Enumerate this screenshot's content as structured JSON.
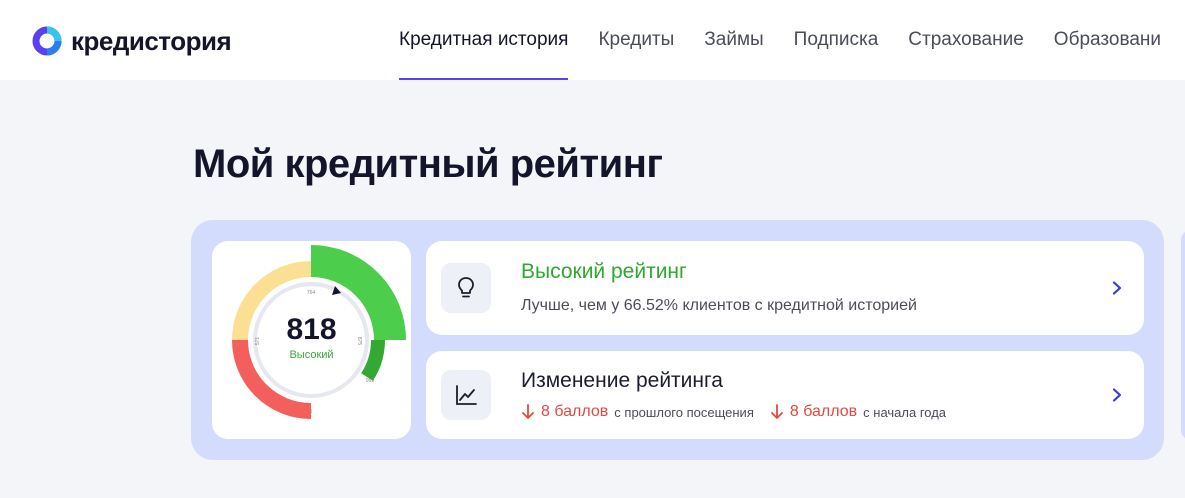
{
  "brand": {
    "name": "кредистория"
  },
  "nav": {
    "items": [
      {
        "label": "Кредитная история",
        "active": true
      },
      {
        "label": "Кредиты",
        "active": false
      },
      {
        "label": "Займы",
        "active": false
      },
      {
        "label": "Подписка",
        "active": false
      },
      {
        "label": "Страхование",
        "active": false
      },
      {
        "label": "Образовани",
        "active": false
      }
    ]
  },
  "page": {
    "title": "Мой кредитный рейтинг"
  },
  "gauge": {
    "score": "818",
    "score_label": "Высокий",
    "ticks": [
      "1",
      "571",
      "764",
      "875",
      "999"
    ],
    "colors": {
      "low": "#f25f5c",
      "mid": "#fbdf93",
      "high": "#4ccd4c",
      "high_dark": "#33a833",
      "track": "#e6e8ef"
    }
  },
  "rating_card": {
    "title": "Высокий рейтинг",
    "subtitle": "Лучше, чем у 66.52% клиентов с кредитной историей",
    "icon": "lightbulb-icon"
  },
  "change_card": {
    "title": "Изменение рейтинга",
    "icon": "chart-line-icon",
    "deltas": [
      {
        "value": "8 баллов",
        "note": "с прошлого посещения",
        "direction": "down"
      },
      {
        "value": "8 баллов",
        "note": "с начала года",
        "direction": "down"
      }
    ]
  },
  "colors": {
    "accent": "#5b3ff0",
    "positive": "#2ea82e",
    "negative": "#e2483f",
    "panel": "#d3dcfd"
  }
}
